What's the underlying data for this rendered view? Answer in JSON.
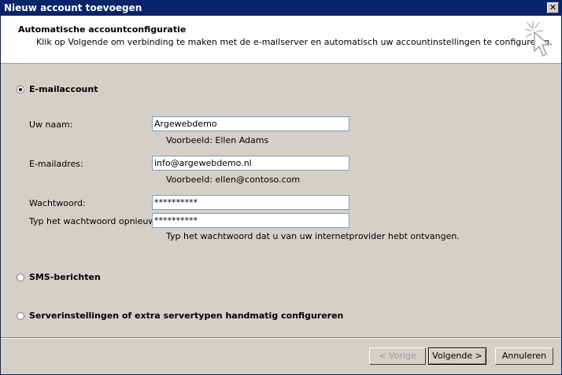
{
  "window": {
    "title": "Nieuw account toevoegen",
    "close_glyph": "✕"
  },
  "header": {
    "title": "Automatische accountconfiguratie",
    "subtitle": "Klik op Volgende om verbinding te maken met de e-mailserver en automatisch uw accountinstellingen te configureren.",
    "icon": "cursor-sparkle-icon"
  },
  "options": {
    "email_account": {
      "label": "E-mailaccount",
      "selected": true
    },
    "sms": {
      "label": "SMS-berichten",
      "selected": false
    },
    "manual": {
      "label": "Serverinstellingen of extra servertypen handmatig configureren",
      "selected": false
    }
  },
  "form": {
    "name": {
      "label": "Uw naam:",
      "value": "Argewebdemo",
      "hint": "Voorbeeld: Ellen Adams"
    },
    "email": {
      "label": "E-mailadres:",
      "value": "info@argewebdemo.nl",
      "hint": "Voorbeeld: ellen@contoso.com"
    },
    "password": {
      "label": "Wachtwoord:",
      "value": "**********"
    },
    "password_repeat": {
      "label": "Typ het wachtwoord opnieuw:",
      "value": "**********",
      "hint": "Typ het wachtwoord dat u van uw internetprovider hebt ontvangen."
    }
  },
  "buttons": {
    "back": "< Vorige",
    "next": "Volgende >",
    "cancel": "Annuleren"
  },
  "colors": {
    "titlebar": "#0a246a",
    "dialog_bg": "#d4d0c8",
    "header_bg": "#ffffff",
    "input_border": "#7f9db9"
  }
}
